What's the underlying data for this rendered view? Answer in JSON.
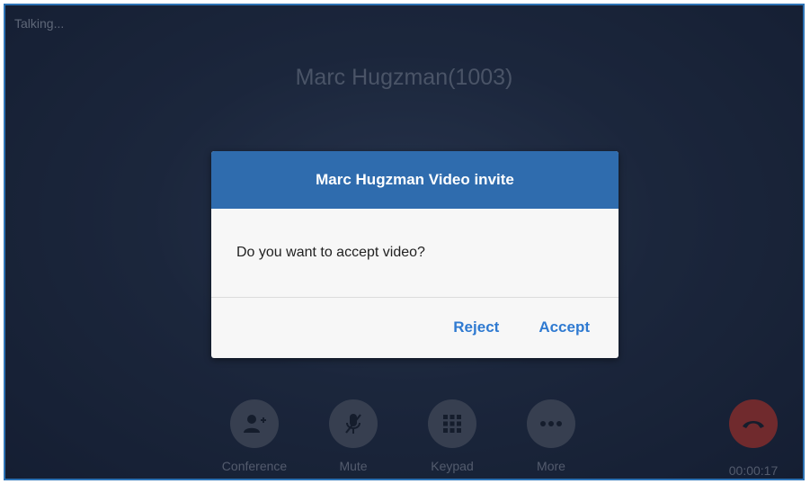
{
  "call": {
    "status": "Talking...",
    "caller": "Marc Hugzman(1003)",
    "duration": "00:00:17"
  },
  "dialog": {
    "title": "Marc Hugzman Video invite",
    "message": "Do you want to accept video?",
    "reject_label": "Reject",
    "accept_label": "Accept"
  },
  "toolbar": {
    "conference_label": "Conference",
    "mute_label": "Mute",
    "keypad_label": "Keypad",
    "more_label": "More"
  },
  "colors": {
    "accent": "#2f6cae",
    "link": "#2f7ad1",
    "hangup": "#a83a38",
    "background": "#26344f"
  },
  "icons": [
    "add-participant-icon",
    "mute-mic-icon",
    "keypad-icon",
    "more-icon",
    "hangup-icon"
  ]
}
